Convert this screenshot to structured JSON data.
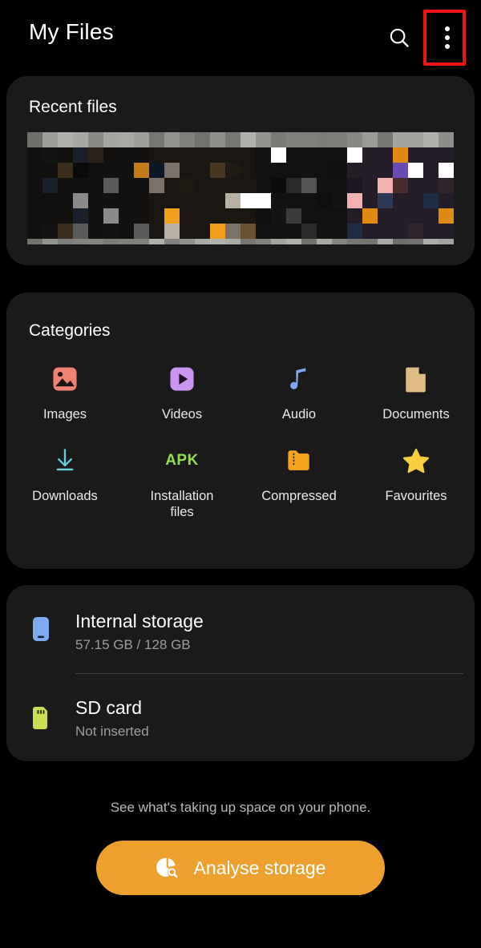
{
  "header": {
    "title": "My Files",
    "search_icon": "search-icon",
    "menu_icon": "more-vertical-icon",
    "highlight_color": "#f01414"
  },
  "recent": {
    "title": "Recent files"
  },
  "categories": {
    "title": "Categories",
    "items": [
      {
        "label": "Images",
        "icon": "image-icon",
        "color": "#ef8270"
      },
      {
        "label": "Videos",
        "icon": "video-play-icon",
        "color": "#cb94ef"
      },
      {
        "label": "Audio",
        "icon": "music-note-icon",
        "color": "#7da7f0"
      },
      {
        "label": "Documents",
        "icon": "document-icon",
        "color": "#dfbb86"
      },
      {
        "label": "Downloads",
        "icon": "download-icon",
        "color": "#67cdd4"
      },
      {
        "label": "Installation\nfiles",
        "icon": "apk-icon",
        "color": "#8fe04a"
      },
      {
        "label": "Compressed",
        "icon": "zip-folder-icon",
        "color": "#f5a31d"
      },
      {
        "label": "Favourites",
        "icon": "star-icon",
        "color": "#f7cf3a"
      }
    ],
    "apk_text": "APK"
  },
  "storage": {
    "rows": [
      {
        "name": "Internal storage",
        "sub": "57.15 GB / 128 GB",
        "icon": "phone-icon",
        "color": "#7cabf0"
      },
      {
        "name": "SD card",
        "sub": "Not inserted",
        "icon": "sdcard-icon",
        "color": "#ccdc53"
      }
    ]
  },
  "footer": {
    "note": "See what's taking up space on your phone.",
    "button_label": "Analyse storage",
    "button_icon": "pie-search-icon",
    "button_color": "#eda02e"
  }
}
